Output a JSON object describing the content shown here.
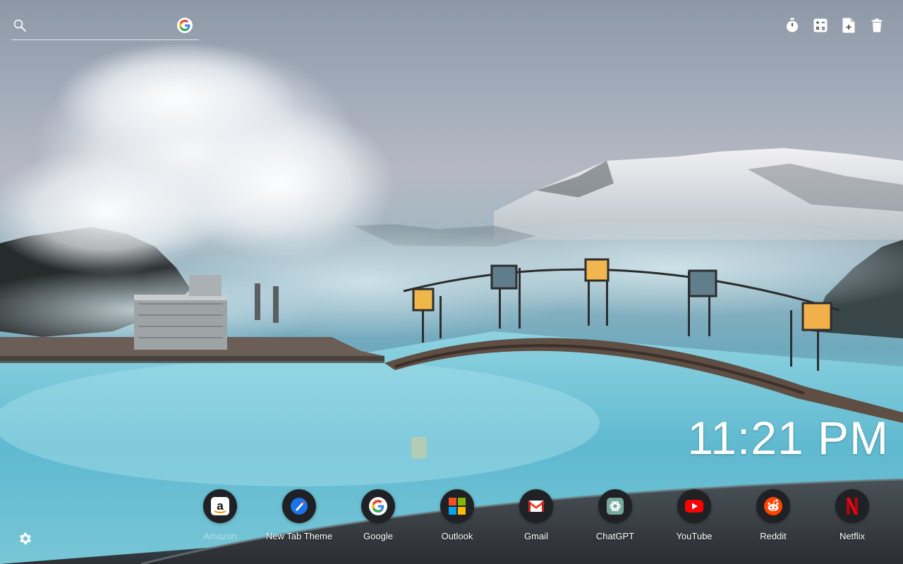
{
  "search": {
    "value": "",
    "placeholder": "",
    "icon": "search-icon",
    "engine_icon": "google-icon"
  },
  "tools": [
    {
      "icon": "timer-icon"
    },
    {
      "icon": "calculator-icon"
    },
    {
      "icon": "add-file-icon"
    },
    {
      "icon": "trash-icon"
    }
  ],
  "clock": {
    "time": "11:21 PM"
  },
  "shortcuts": [
    {
      "label": "Amazon",
      "icon": "amazon-icon"
    },
    {
      "label": "New Tab Theme",
      "icon": "new-tab-theme-icon"
    },
    {
      "label": "Google",
      "icon": "google-icon"
    },
    {
      "label": "Outlook",
      "icon": "microsoft-icon"
    },
    {
      "label": "Gmail",
      "icon": "gmail-icon"
    },
    {
      "label": "ChatGPT",
      "icon": "chatgpt-icon"
    },
    {
      "label": "YouTube",
      "icon": "youtube-icon"
    },
    {
      "label": "Reddit",
      "icon": "reddit-icon"
    },
    {
      "label": "Netflix",
      "icon": "netflix-icon"
    }
  ],
  "settings": {
    "icon": "gear-icon"
  },
  "colors": {
    "shortcut_bg": "#1f2124",
    "youtube_red": "#ff0000",
    "reddit_orange": "#ff4500",
    "netflix_red": "#e50914",
    "google_blue": "#4285f4",
    "google_red": "#ea4335",
    "google_yellow": "#fbbc05",
    "google_green": "#34a853"
  }
}
